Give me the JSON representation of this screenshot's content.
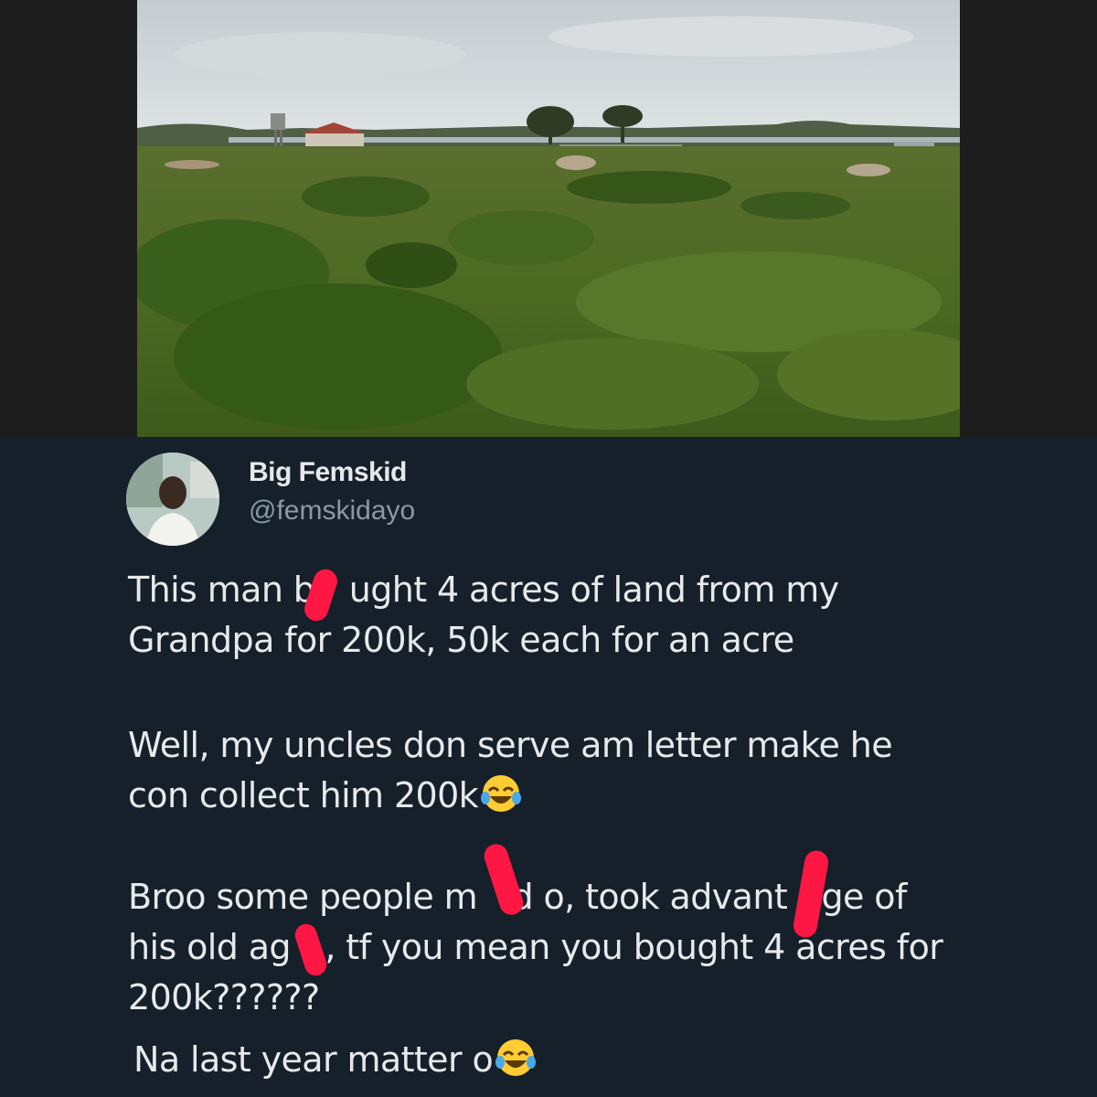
{
  "tweet": {
    "author": {
      "display_name": "Big Femskid",
      "handle": "@femskidayo"
    },
    "paragraphs": [
      "This man b ught 4 acres of land from my\nGrandpa for 200k, 50k each for an acre",
      "Well, my uncles don serve am letter make he\ncon collect him 200k",
      "Broo some people m d o, took advant ge of\nhis old ag , tf you mean you bought 4 acres for\n200k??????",
      "Na last year matter o"
    ],
    "emoji": "face-with-tears-of-joy-icon"
  },
  "colors": {
    "background": "#15202b",
    "text": "#e7e9ea",
    "handle": "#8b98a5",
    "redaction": "#ff1744"
  }
}
